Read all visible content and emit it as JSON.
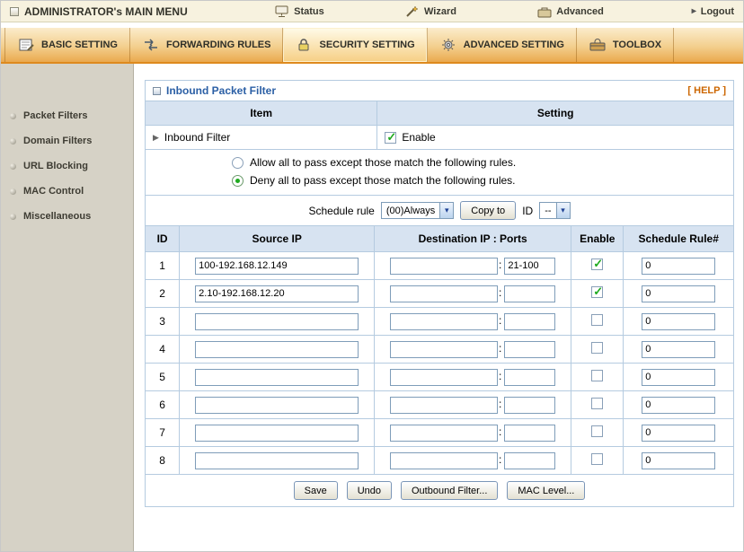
{
  "colors": {
    "tab_accent": "#de8a1e",
    "header_blue": "#d7e3f1",
    "title_blue": "#2b5fa5",
    "help_orange": "#cc6600",
    "check_green": "#1faa1f"
  },
  "top": {
    "title": "ADMINISTRATOR's MAIN MENU",
    "menu": [
      {
        "label": "Status"
      },
      {
        "label": "Wizard"
      },
      {
        "label": "Advanced"
      }
    ],
    "logout_label": "Logout"
  },
  "tabs": [
    {
      "label": "BASIC SETTING",
      "active": false
    },
    {
      "label": "FORWARDING RULES",
      "active": false
    },
    {
      "label": "SECURITY SETTING",
      "active": true
    },
    {
      "label": "ADVANCED SETTING",
      "active": false
    },
    {
      "label": "TOOLBOX",
      "active": false
    }
  ],
  "sidebar": {
    "items": [
      {
        "label": "Packet Filters"
      },
      {
        "label": "Domain Filters"
      },
      {
        "label": "URL Blocking"
      },
      {
        "label": "MAC Control"
      },
      {
        "label": "Miscellaneous"
      }
    ]
  },
  "panel": {
    "title": "Inbound Packet Filter",
    "help_label": "[ HELP ]",
    "columns": {
      "item": "Item",
      "setting": "Setting"
    },
    "inbound_filter": {
      "label": "Inbound Filter",
      "enable_label": "Enable",
      "enabled": true
    },
    "policy": {
      "allow_label": "Allow all to pass except those match the following rules.",
      "deny_label": "Deny all to pass except those match the following rules.",
      "selected": "deny"
    },
    "schedule": {
      "label": "Schedule rule",
      "value": "(00)Always",
      "copy_button": "Copy to",
      "id_label": "ID",
      "id_value": "--"
    },
    "table": {
      "headers": [
        "ID",
        "Source IP",
        "Destination IP : Ports",
        "Enable",
        "Schedule Rule#"
      ],
      "rows": [
        {
          "id": "1",
          "source_ip": "100-192.168.12.149",
          "dest_ip": "",
          "ports": "21-100",
          "enabled": true,
          "schedule": "0"
        },
        {
          "id": "2",
          "source_ip": "2.10-192.168.12.20",
          "dest_ip": "",
          "ports": "",
          "enabled": true,
          "schedule": "0"
        },
        {
          "id": "3",
          "source_ip": "",
          "dest_ip": "",
          "ports": "",
          "enabled": false,
          "schedule": "0"
        },
        {
          "id": "4",
          "source_ip": "",
          "dest_ip": "",
          "ports": "",
          "enabled": false,
          "schedule": "0"
        },
        {
          "id": "5",
          "source_ip": "",
          "dest_ip": "",
          "ports": "",
          "enabled": false,
          "schedule": "0"
        },
        {
          "id": "6",
          "source_ip": "",
          "dest_ip": "",
          "ports": "",
          "enabled": false,
          "schedule": "0"
        },
        {
          "id": "7",
          "source_ip": "",
          "dest_ip": "",
          "ports": "",
          "enabled": false,
          "schedule": "0"
        },
        {
          "id": "8",
          "source_ip": "",
          "dest_ip": "",
          "ports": "",
          "enabled": false,
          "schedule": "0"
        }
      ]
    },
    "buttons": [
      {
        "label": "Save"
      },
      {
        "label": "Undo"
      },
      {
        "label": "Outbound Filter..."
      },
      {
        "label": "MAC Level..."
      }
    ]
  }
}
